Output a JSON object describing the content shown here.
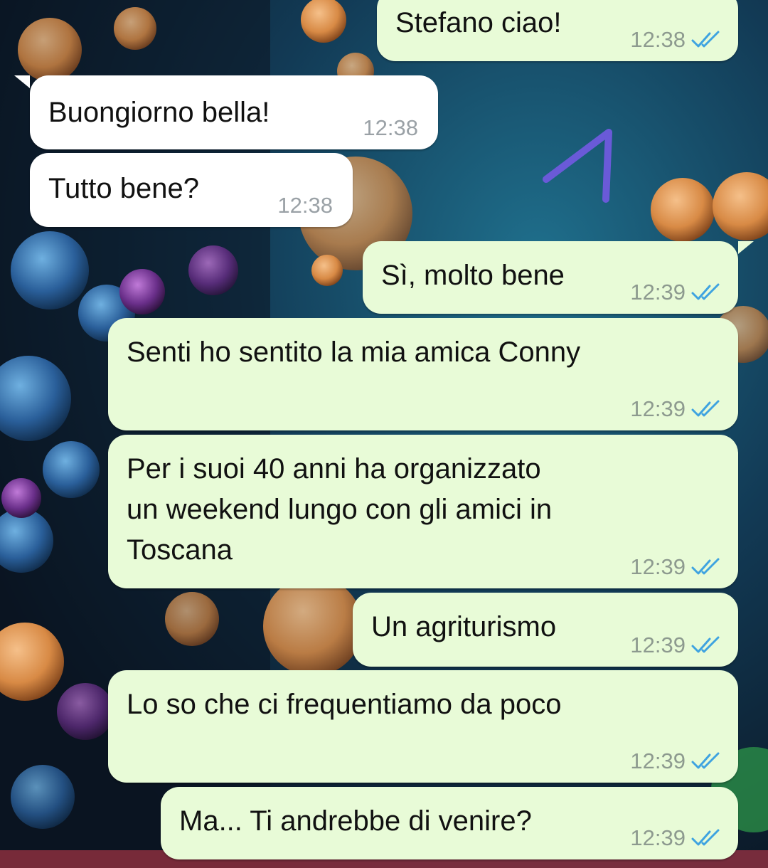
{
  "colors": {
    "outgoing_bubble": "#e8fbd7",
    "incoming_bubble": "#ffffff",
    "read_ticks": "#3fa3e0",
    "doodle_stroke": "#6a5ad8"
  },
  "messages": [
    {
      "direction": "outgoing",
      "text": "Stefano ciao!",
      "time": "12:38",
      "status_icon": "double-check-read-icon"
    },
    {
      "direction": "incoming",
      "text": "Buongiorno bella!",
      "time": "12:38"
    },
    {
      "direction": "incoming",
      "text": "Tutto bene?",
      "time": "12:38"
    },
    {
      "direction": "outgoing",
      "text": "Sì, molto bene",
      "time": "12:39",
      "status_icon": "double-check-read-icon"
    },
    {
      "direction": "outgoing",
      "text": "Senti ho sentito la mia amica Conny",
      "time": "12:39",
      "status_icon": "double-check-read-icon"
    },
    {
      "direction": "outgoing",
      "text": "Per i suoi 40 anni ha organizzato\nun weekend lungo con gli amici in\nToscana",
      "time": "12:39",
      "status_icon": "double-check-read-icon"
    },
    {
      "direction": "outgoing",
      "text": "Un agriturismo",
      "time": "12:39",
      "status_icon": "double-check-read-icon"
    },
    {
      "direction": "outgoing",
      "text": "Lo so che ci frequentiamo da poco",
      "time": "12:39",
      "status_icon": "double-check-read-icon"
    },
    {
      "direction": "outgoing",
      "text": "Ma... Ti andrebbe di venire?",
      "time": "12:39",
      "status_icon": "double-check-read-icon"
    }
  ]
}
